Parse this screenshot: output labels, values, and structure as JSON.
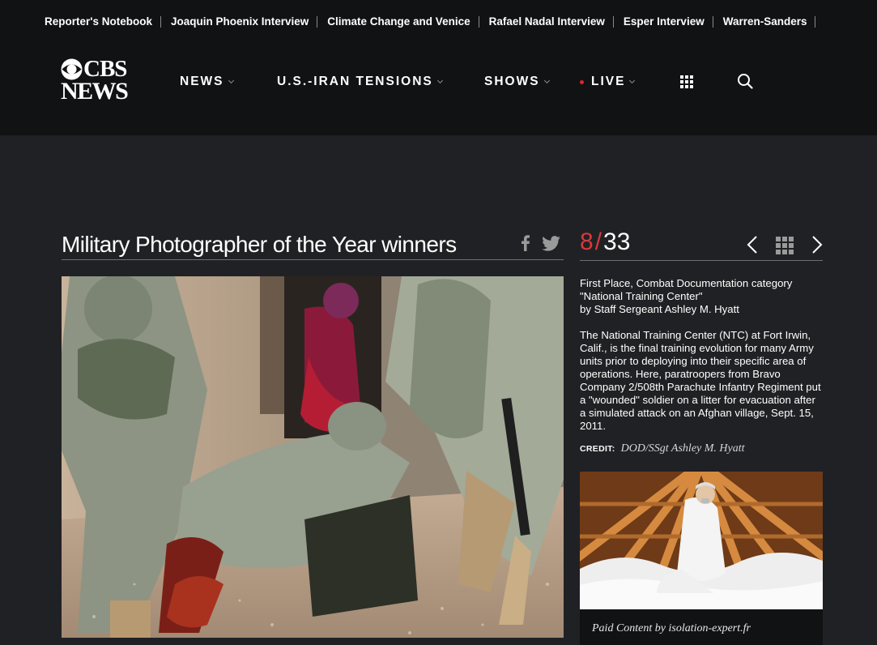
{
  "trending": [
    "Reporter's Notebook",
    "Joaquin Phoenix Interview",
    "Climate Change and Venice",
    "Rafael Nadal Interview",
    "Esper Interview",
    "Warren-Sanders"
  ],
  "logo": {
    "line1": "CBS",
    "line2": "NEWS"
  },
  "nav": {
    "news": "NEWS",
    "iran": "U.S.-IRAN TENSIONS",
    "shows": "SHOWS",
    "live": "LIVE"
  },
  "icons": {
    "menu": "grid-icon",
    "search": "search-icon",
    "facebook": "facebook-icon",
    "twitter": "twitter-icon",
    "prev": "chevron-left-icon",
    "thumbs": "grid-icon",
    "next": "chevron-right-icon"
  },
  "colors": {
    "accent": "#d8383d",
    "live_dot": "#e0262b",
    "background": "#202124",
    "masthead": "#111213"
  },
  "gallery": {
    "title": "Military Photographer of the Year winners",
    "current": "8",
    "separator": "/",
    "total": "33",
    "caption_line1": "First Place, Combat Documentation category",
    "caption_line2": "\"National Training Center\"",
    "caption_line3": "by Staff Sergeant Ashley M. Hyatt",
    "description": "The National Training Center (NTC) at Fort Irwin, Calif., is the final training evolution for many Army units prior to deploying into their specific area of operations. Here, paratroopers from Bravo Company 2/508th Parachute Infantry Regiment put a \"wounded\" soldier on a litter for evacuation after a simulated attack on an Afghan village, Sept. 15, 2011.",
    "credit_label": "CREDIT:",
    "credit_value": "DOD/SSgt Ashley M. Hyatt"
  },
  "ad": {
    "caption": "Paid Content by isolation-expert.fr"
  }
}
